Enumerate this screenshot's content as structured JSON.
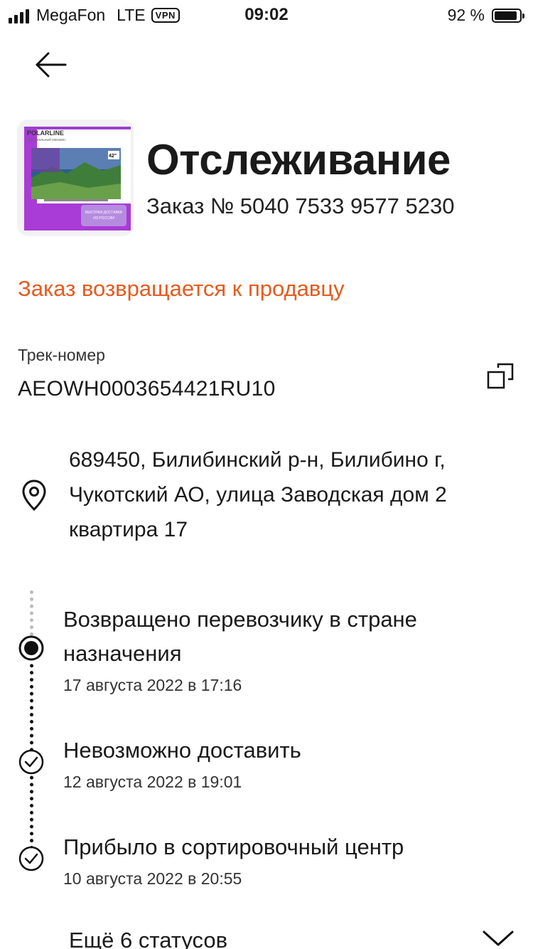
{
  "status_bar": {
    "carrier": "MegaFon",
    "network": "LTE",
    "vpn": "VPN",
    "time": "09:02",
    "battery_percent": "92 %",
    "battery_level": 0.92
  },
  "header": {
    "title": "Отслеживание",
    "order_number": "Заказ № 5040 7533 9577 5230",
    "product_image": {
      "brand": "POLARLINE",
      "subtitle": "Официальный магазин",
      "size_badge": "42\"",
      "promo": "БЫСТРАЯ ДОСТАВКА ИЗ РОССИИ"
    }
  },
  "order_status": "Заказ возвращается к продавцу",
  "status_color": "#e65a1e",
  "tracking": {
    "label": "Трек-номер",
    "number": "AEOWH0003654421RU10"
  },
  "address": "689450, Билибинский р-н, Билибино г, Чукотский АО, улица Заводская дом 2 квартира 17",
  "events": [
    {
      "title": "Возвращено перевозчику в стране назначения",
      "date": "17 августа 2022 в 17:16",
      "icon": "current-dot-icon"
    },
    {
      "title": "Невозможно доставить",
      "date": "12 августа 2022 в 19:01",
      "icon": "check-circle-icon"
    },
    {
      "title": "Прибыло в сортировочный центр",
      "date": "10 августа 2022 в 20:55",
      "icon": "check-circle-icon"
    }
  ],
  "more_statuses": "Ещё 6 статусов"
}
